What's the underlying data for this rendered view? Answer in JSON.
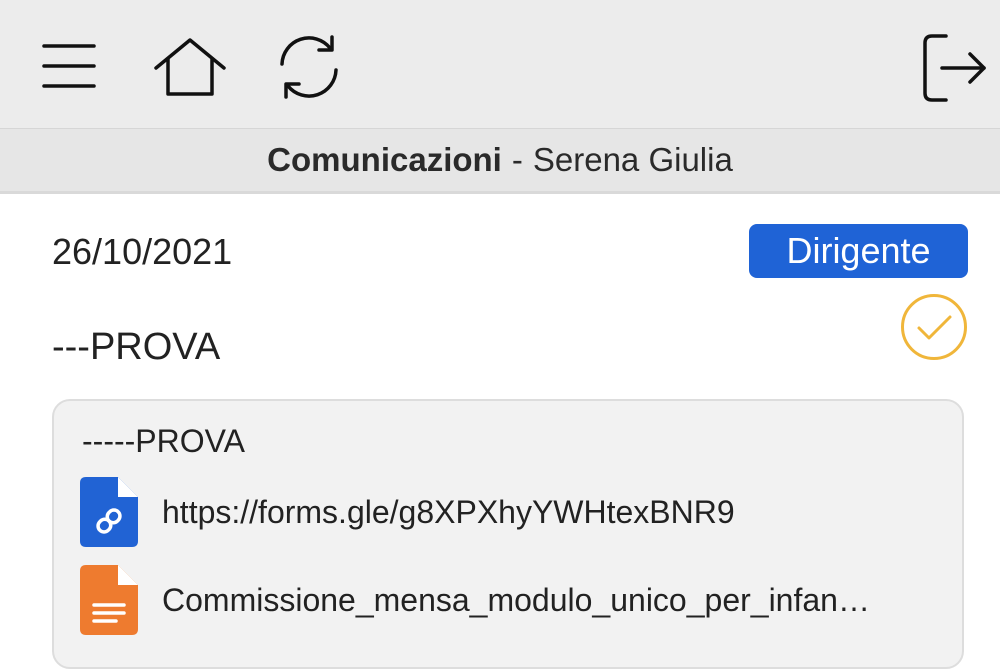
{
  "toolbar": {
    "menu_icon": "hamburger-menu-icon",
    "home_icon": "home-icon",
    "refresh_icon": "refresh-icon",
    "logout_icon": "logout-icon"
  },
  "header": {
    "section": "Comunicazioni",
    "separator": "-",
    "student": "Serena Giulia"
  },
  "message": {
    "date": "26/10/2021",
    "author_badge": "Dirigente",
    "read_icon": "check-circle-icon",
    "subject": "---PROVA",
    "body": "-----PROVA",
    "attachments": [
      {
        "type": "link",
        "icon": "link-file-icon",
        "color": "#2163d4",
        "label": "https://forms.gle/g8XPXhyYWHtexBNR9"
      },
      {
        "type": "document",
        "icon": "document-file-icon",
        "color": "#ee7b2f",
        "label": "Commissione_mensa_modulo_unico_per_infan…"
      }
    ]
  },
  "colors": {
    "badge": "#1f63d6",
    "read_check": "#f0b63a",
    "toolbar_bg": "#ececec"
  }
}
